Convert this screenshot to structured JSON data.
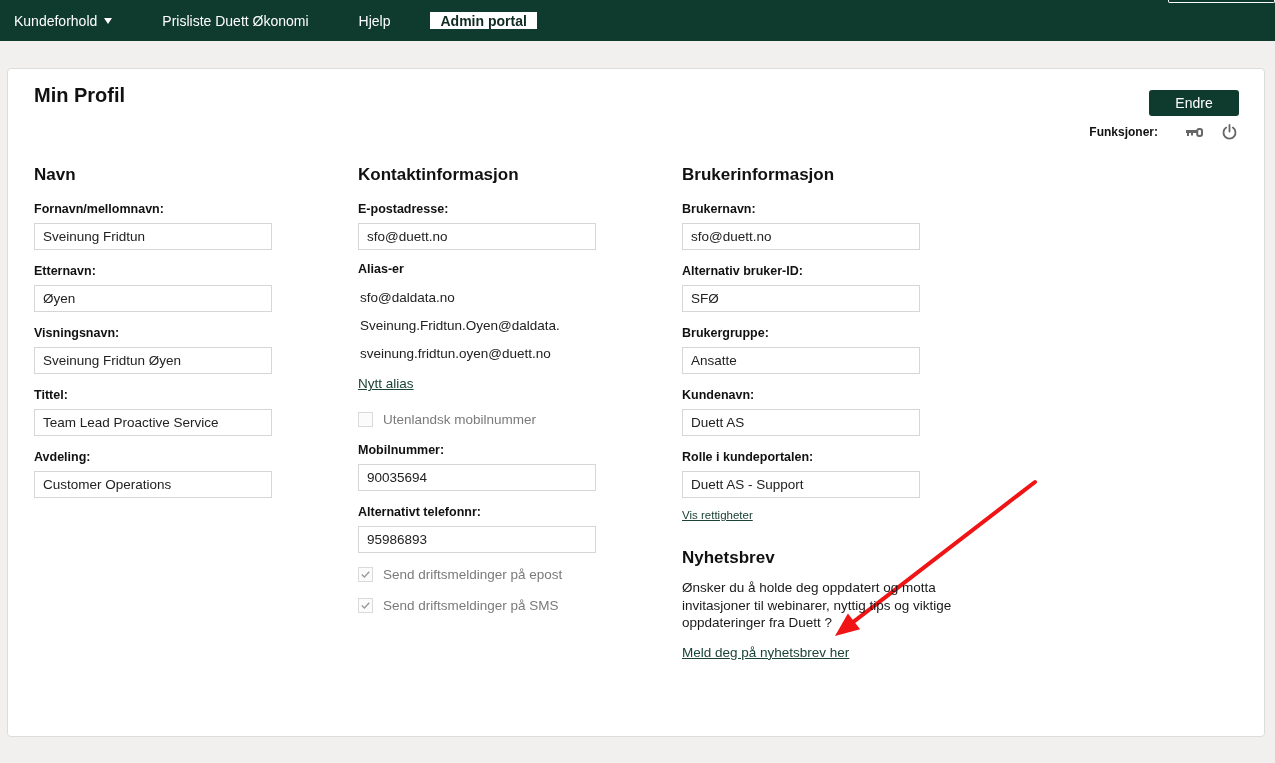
{
  "nav": {
    "items": [
      {
        "label": "Kundeforhold",
        "dropdown": true,
        "selected": false
      },
      {
        "label": "Prisliste Duett Økonomi",
        "dropdown": false,
        "selected": false
      },
      {
        "label": "Hjelp",
        "dropdown": false,
        "selected": false
      },
      {
        "label": "Admin portal",
        "dropdown": false,
        "selected": true
      }
    ]
  },
  "page": {
    "title": "Min Profil",
    "edit_button": "Endre",
    "functions_label": "Funksjoner:"
  },
  "columns": [
    {
      "heading": "Navn",
      "items": [
        {
          "kind": "field",
          "label": "Fornavn/mellomnavn:",
          "value": "Sveinung Fridtun"
        },
        {
          "kind": "field",
          "label": "Etternavn:",
          "value": "Øyen"
        },
        {
          "kind": "field",
          "label": "Visningsnavn:",
          "value": "Sveinung Fridtun Øyen"
        },
        {
          "kind": "field",
          "label": "Tittel:",
          "value": "Team Lead Proactive Service"
        },
        {
          "kind": "field",
          "label": "Avdeling:",
          "value": "Customer Operations"
        }
      ]
    },
    {
      "heading": "Kontaktinformasjon",
      "items": [
        {
          "kind": "field",
          "label": "E-postadresse:",
          "value": "sfo@duett.no"
        },
        {
          "kind": "list",
          "label": "Alias-er",
          "entries": [
            "sfo@daldata.no",
            "Sveinung.Fridtun.Oyen@daldata.",
            "sveinung.fridtun.oyen@duett.no"
          ]
        },
        {
          "kind": "link",
          "text": "Nytt alias"
        },
        {
          "kind": "checkbox",
          "label": "Utenlandsk mobilnummer",
          "checked": false,
          "disabled": true
        },
        {
          "kind": "field",
          "label": "Mobilnummer:",
          "value": "90035694"
        },
        {
          "kind": "field",
          "label": "Alternativt telefonnr:",
          "value": "95986893"
        },
        {
          "kind": "checkbox",
          "label": "Send driftsmeldinger på epost",
          "checked": true,
          "disabled": true
        },
        {
          "kind": "checkbox",
          "label": "Send driftsmeldinger på SMS",
          "checked": true,
          "disabled": true
        }
      ]
    },
    {
      "heading": "Brukerinformasjon",
      "items": [
        {
          "kind": "field",
          "label": "Brukernavn:",
          "value": "sfo@duett.no"
        },
        {
          "kind": "field",
          "label": "Alternativ bruker-ID:",
          "value": "SFØ"
        },
        {
          "kind": "field",
          "label": "Brukergruppe:",
          "value": "Ansatte"
        },
        {
          "kind": "field",
          "label": "Kundenavn:",
          "value": "Duett AS"
        },
        {
          "kind": "field",
          "label": "Rolle i kundeportalen:",
          "value": "Duett AS - Support"
        },
        {
          "kind": "small_link",
          "text": "Vis rettigheter"
        },
        {
          "kind": "heading",
          "text": "Nyhetsbrev"
        },
        {
          "kind": "paragraph",
          "text": "Ønsker du å holde deg oppdatert og motta invitasjoner til webinarer, nyttig tips og viktige oppdateringer fra Duett ?"
        },
        {
          "kind": "link",
          "text": "Meld deg på nyhetsbrev her"
        }
      ]
    }
  ]
}
